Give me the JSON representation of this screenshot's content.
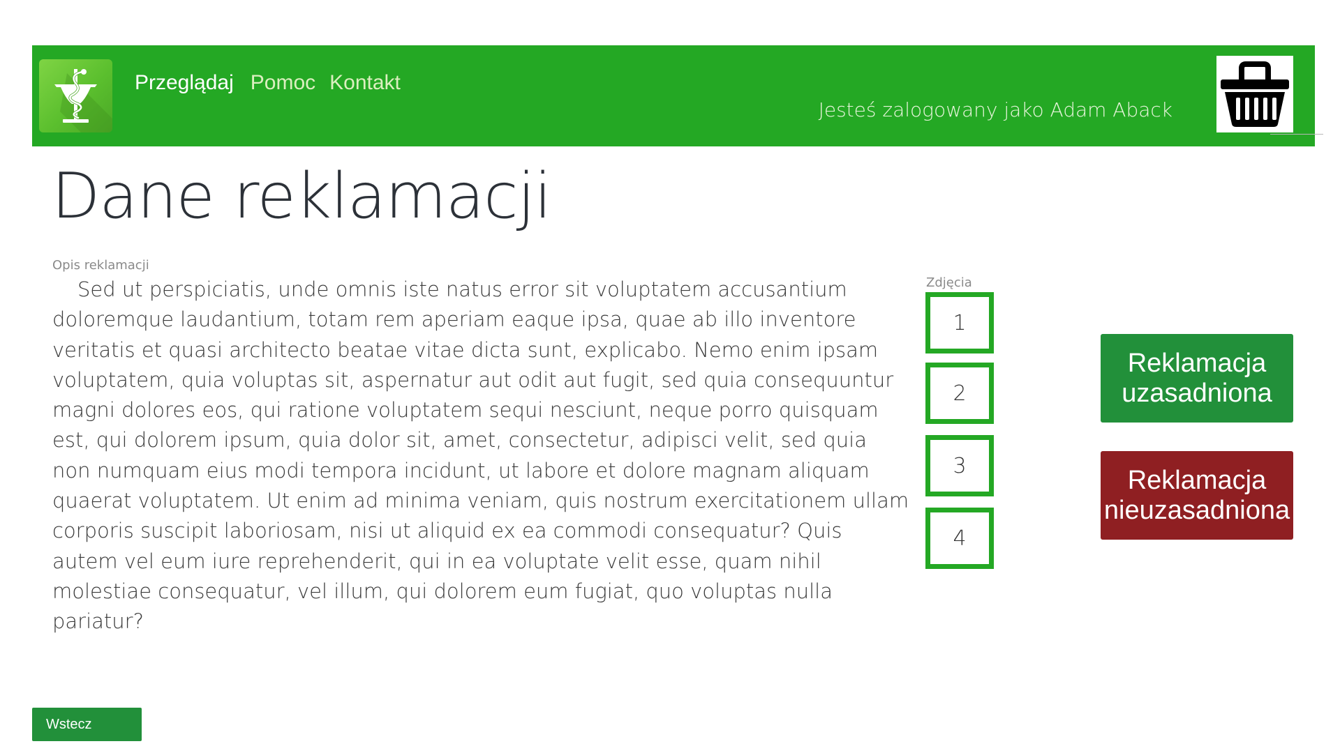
{
  "header": {
    "logo_icon": "pharmacy-caduceus-icon",
    "nav": [
      "Przeglądaj",
      "Pomoc",
      "Kontakt"
    ],
    "user_text": "Jesteś zalogowany jako Adam Aback",
    "cart_icon": "shopping-basket-icon",
    "bar_color": "#24a824"
  },
  "main": {
    "title": "Dane reklamacji",
    "description_label": "Opis reklamacji",
    "description": "Sed ut perspiciatis, unde omnis iste natus error sit voluptatem accusantium doloremque laudantium, totam rem aperiam eaque ipsa, quae ab illo inventore veritatis et quasi architecto beatae vitae dicta sunt, explicabo. Nemo enim ipsam voluptatem, quia voluptas sit, aspernatur aut odit aut fugit, sed quia consequuntur magni dolores eos, qui ratione voluptatem sequi nesciunt, neque porro quisquam est, qui dolorem ipsum, quia dolor sit, amet, consectetur, adipisci velit, sed quia non numquam eius modi tempora incidunt, ut labore et dolore magnam aliquam quaerat voluptatem. Ut enim ad minima veniam, quis nostrum exercitationem ullam corporis suscipit laboriosam, nisi ut aliquid ex ea commodi consequatur? Quis autem vel eum iure reprehenderit, qui in ea voluptate velit esse, quam nihil molestiae consequatur, vel illum, qui dolorem eum fugiat, quo voluptas nulla pariatur?",
    "photos_label": "Zdjęcia",
    "photos": [
      "1",
      "2",
      "3",
      "4"
    ]
  },
  "actions": {
    "valid_label": "Reklamacja uzasadniona",
    "invalid_label": "Reklamacja nieuzasadniona",
    "valid_color": "#22903a",
    "invalid_color": "#8f1f22"
  },
  "footer": {
    "back_label": "Wstecz"
  }
}
